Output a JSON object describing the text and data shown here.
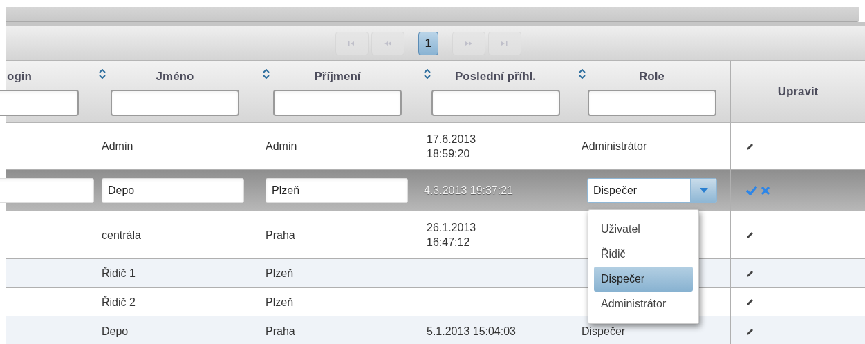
{
  "paginator": {
    "nav_disabled": true,
    "pages": [
      {
        "label": "1",
        "selected": true
      }
    ]
  },
  "columns": [
    {
      "label": "ogin",
      "sortable": false,
      "filter": true
    },
    {
      "label": "Jméno",
      "sortable": true,
      "filter": true
    },
    {
      "label": "Příjmení",
      "sortable": true,
      "filter": true
    },
    {
      "label": "Poslední příhl.",
      "sortable": true,
      "filter": true
    },
    {
      "label": "Role",
      "sortable": true,
      "filter": true
    },
    {
      "label": "Upravit",
      "sortable": false,
      "filter": false
    }
  ],
  "rows": [
    {
      "kind": "view",
      "name": "Admin",
      "surname": "Admin",
      "last_login": "17.6.2013\n18:59:20",
      "role": "Administrátor"
    },
    {
      "kind": "edit",
      "name": "Depo",
      "surname": "Plzeň",
      "last_login": "4.3.2013 19:37:21",
      "role": "Dispečer"
    },
    {
      "kind": "view",
      "name": "centrála",
      "surname": "Praha",
      "last_login": "26.1.2013\n16:47:12"
    },
    {
      "kind": "view",
      "name": "Řidič 1",
      "surname": "Plzeň"
    },
    {
      "kind": "view",
      "name": "Řidič 2",
      "surname": "Plzeň"
    },
    {
      "kind": "view",
      "name": "Depo",
      "surname": "Praha",
      "last_login": "5.1.2013 15:04:03",
      "role": "Dispečer"
    }
  ],
  "role_dropdown": {
    "options": [
      {
        "label": "Uživatel",
        "selected": false
      },
      {
        "label": "Řidič",
        "selected": false
      },
      {
        "label": "Dispečer",
        "selected": true
      },
      {
        "label": "Administrátor",
        "selected": false
      }
    ]
  }
}
